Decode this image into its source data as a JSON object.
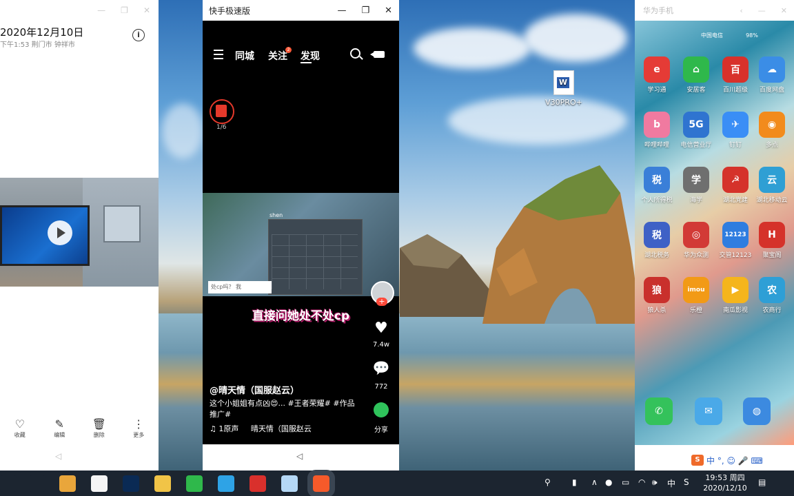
{
  "left_window": {
    "date": "2020年12月10日",
    "subtitle": "下午1:53 荆门市 钟祥市",
    "actions": [
      {
        "icon": "heart-icon",
        "label": "收藏"
      },
      {
        "icon": "pencil-icon",
        "label": "编辑"
      },
      {
        "icon": "trash-icon",
        "label": "删除"
      },
      {
        "icon": "more-icon",
        "label": "更多"
      }
    ]
  },
  "desktop": {
    "file_icon_label": "V30PRO+"
  },
  "kuaishou": {
    "title": "快手极速版",
    "tabs": [
      "同城",
      "关注",
      "发现"
    ],
    "active_tab": "发现",
    "follow_badge": "2",
    "red_packet_count": "1/6",
    "video_overlay_tag": "shen",
    "video_input_text": "处cp吗？ 我",
    "caption_big": "直接问她处不处cp",
    "likes": "7.4w",
    "comments": "772",
    "share": "分享",
    "username": "@晴天情（国服赵云）",
    "description": "这个小姐姐有点凶😍... #王者荣耀# #作品推广#",
    "music_prefix": "♫ 1原声",
    "music_author": "晴天情（国服赵云"
  },
  "phone": {
    "window_title": "华为手机",
    "status_carrier": "中国电信",
    "status_battery": "98%",
    "apps": [
      {
        "label": "学习通",
        "icon": "e",
        "color": "#e53b36"
      },
      {
        "label": "安居客",
        "icon": "⌂",
        "color": "#2fb84b"
      },
      {
        "label": "百川超级",
        "icon": "百",
        "color": "#d8312b"
      },
      {
        "label": "百度网盘",
        "icon": "☁",
        "color": "#3b8de6"
      },
      {
        "label": "哔哩哔哩",
        "icon": "b",
        "color": "#f07aa0"
      },
      {
        "label": "电信营业厅",
        "icon": "5G",
        "color": "#2f74d0"
      },
      {
        "label": "钉钉",
        "icon": "✈",
        "color": "#3a8ef6"
      },
      {
        "label": "多点",
        "icon": "◉",
        "color": "#f28b1c"
      },
      {
        "label": "个人所得税",
        "icon": "税",
        "color": "#3a7fd8"
      },
      {
        "label": "海学",
        "icon": "学",
        "color": "#6f6f6f"
      },
      {
        "label": "湖北党建",
        "icon": "☭",
        "color": "#d5322a"
      },
      {
        "label": "湖北移动云",
        "icon": "云",
        "color": "#2f9fd4"
      },
      {
        "label": "湖北税务",
        "icon": "税",
        "color": "#3e61c6"
      },
      {
        "label": "华为众测",
        "icon": "◎",
        "color": "#d23a36"
      },
      {
        "label": "交管12123",
        "icon": "12123",
        "color": "#2f7de0"
      },
      {
        "label": "聚宝阁",
        "icon": "H",
        "color": "#d5322a"
      },
      {
        "label": "狼人杀",
        "icon": "狼",
        "color": "#c9302c"
      },
      {
        "label": "乐橙",
        "icon": "imou",
        "color": "#f29a16"
      },
      {
        "label": "南瓜影视",
        "icon": "▶",
        "color": "#f5b51c"
      },
      {
        "label": "农商行",
        "icon": "农",
        "color": "#2e9fd6"
      }
    ],
    "dock": [
      {
        "label": "电话",
        "icon": "✆",
        "color": "#34c25b"
      },
      {
        "label": "信息",
        "icon": "✉",
        "color": "#4aa9e8"
      },
      {
        "label": "浏览器",
        "icon": "◍",
        "color": "#3c8ae0"
      }
    ],
    "ime_text": "中 °, ☺ 🎤 ⌨"
  },
  "taskbar": {
    "time": "19:53 周四",
    "date": "2020/12/10",
    "ime_indicator": "中",
    "apps": [
      {
        "name": "search-icon",
        "color": "#1c2530"
      },
      {
        "name": "task-view-icon",
        "color": "#1c2530"
      },
      {
        "name": "chrome-icon",
        "color": "#e9a63b"
      },
      {
        "name": "mindmap-icon",
        "color": "#f5f5f5"
      },
      {
        "name": "photoshop-icon",
        "color": "#0a2a54"
      },
      {
        "name": "file-explorer-icon",
        "color": "#f1c447"
      },
      {
        "name": "wechat-icon",
        "color": "#2fb84b"
      },
      {
        "name": "screen-share-icon",
        "color": "#2ea3e6"
      },
      {
        "name": "record-icon",
        "color": "#d9302c"
      },
      {
        "name": "colorpicker-icon",
        "color": "#b5d8f6"
      },
      {
        "name": "kuaishou-icon",
        "color": "#f55a2a"
      }
    ]
  }
}
